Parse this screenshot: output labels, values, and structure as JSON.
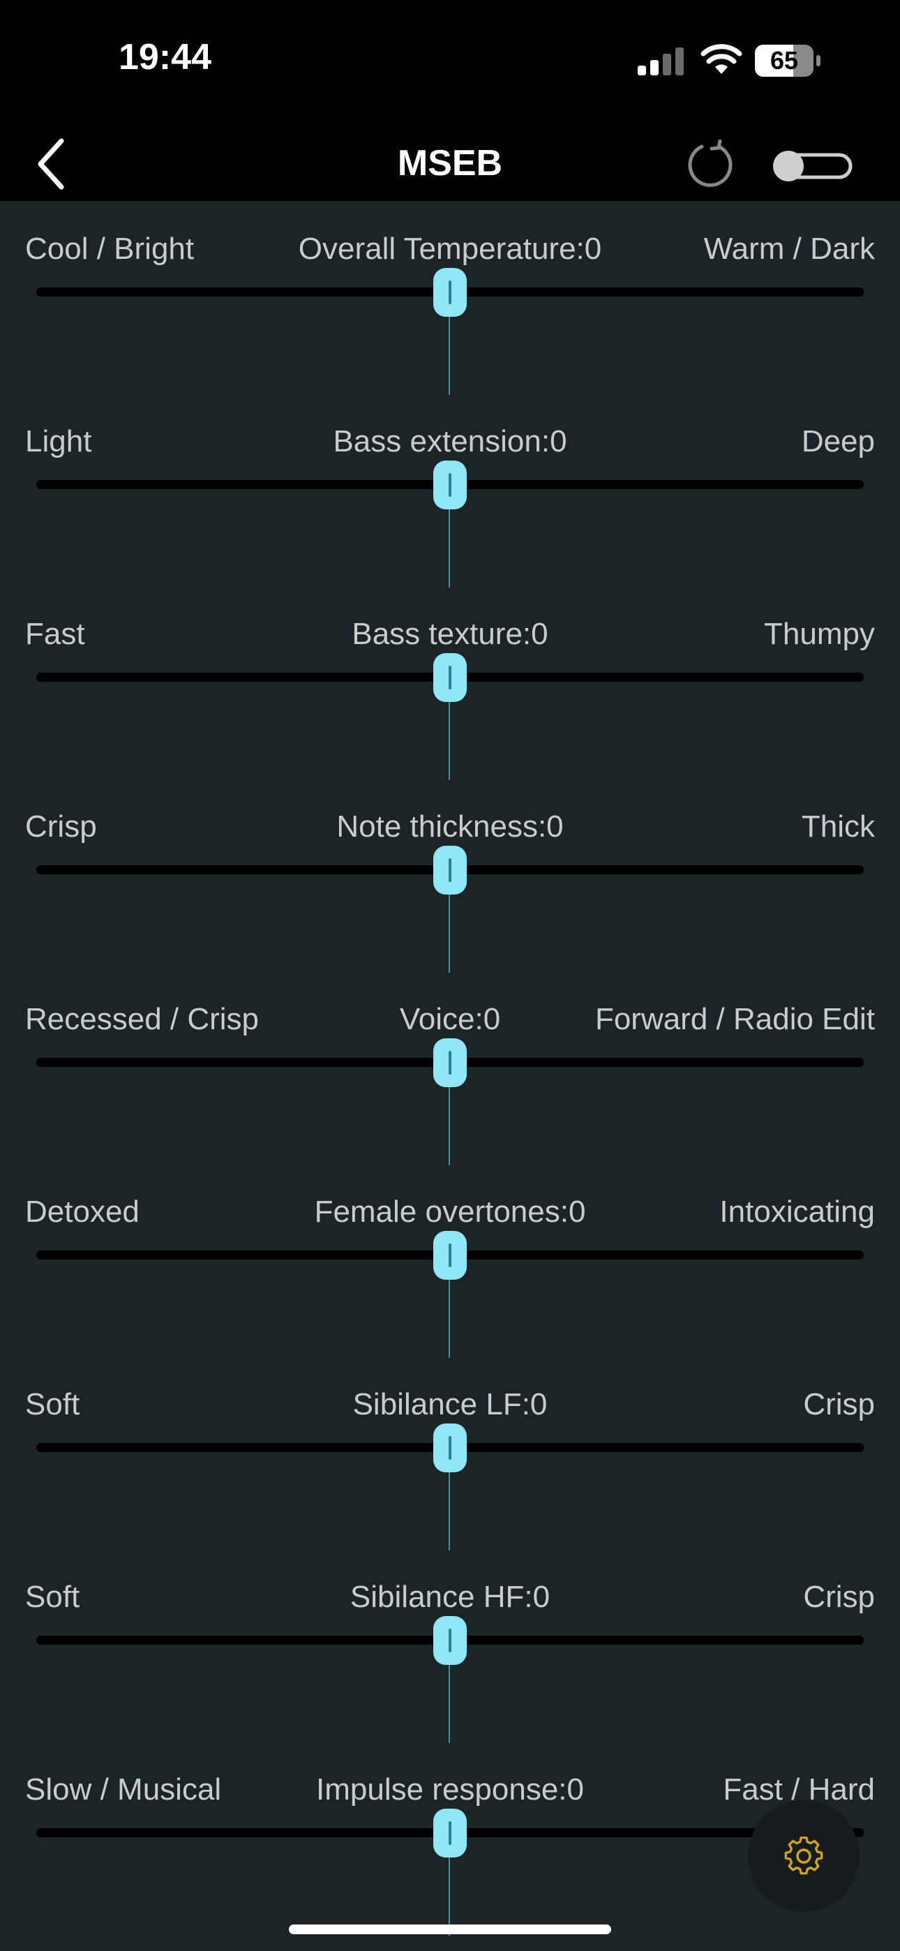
{
  "status_bar": {
    "time": "19:44",
    "battery_percent": "65"
  },
  "header": {
    "title": "MSEB",
    "reset_icon": "reset-icon",
    "toggle_state": "off"
  },
  "colors": {
    "background": "#1d2427",
    "thumb": "#8fe6f4",
    "accent_gear": "#d4a514"
  },
  "sliders": [
    {
      "left": "Cool / Bright",
      "center": "Overall Temperature:0",
      "right": "Warm / Dark",
      "value": 0,
      "min": -100,
      "max": 100
    },
    {
      "left": "Light",
      "center": "Bass extension:0",
      "right": "Deep",
      "value": 0,
      "min": -100,
      "max": 100
    },
    {
      "left": "Fast",
      "center": "Bass texture:0",
      "right": "Thumpy",
      "value": 0,
      "min": -100,
      "max": 100
    },
    {
      "left": "Crisp",
      "center": "Note thickness:0",
      "right": "Thick",
      "value": 0,
      "min": -100,
      "max": 100
    },
    {
      "left": "Recessed / Crisp",
      "center": "Voice:0",
      "right": "Forward / Radio Edit",
      "value": 0,
      "min": -100,
      "max": 100
    },
    {
      "left": "Detoxed",
      "center": "Female overtones:0",
      "right": "Intoxicating",
      "value": 0,
      "min": -100,
      "max": 100
    },
    {
      "left": "Soft",
      "center": "Sibilance LF:0",
      "right": "Crisp",
      "value": 0,
      "min": -100,
      "max": 100
    },
    {
      "left": "Soft",
      "center": "Sibilance HF:0",
      "right": "Crisp",
      "value": 0,
      "min": -100,
      "max": 100
    },
    {
      "left": "Slow / Musical",
      "center": "Impulse response:0",
      "right": "Fast / Hard",
      "value": 0,
      "min": -100,
      "max": 100
    }
  ]
}
